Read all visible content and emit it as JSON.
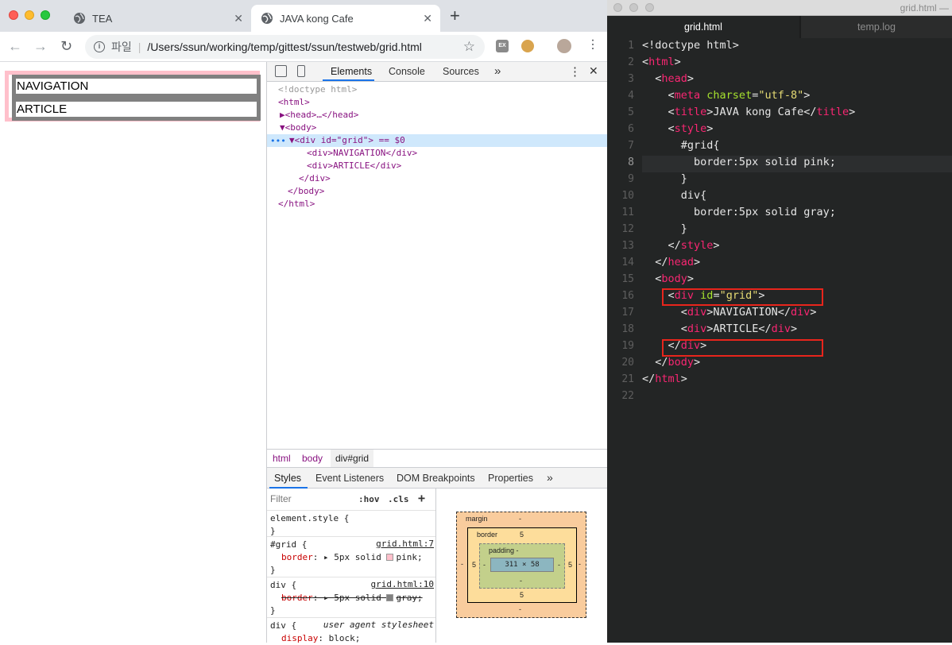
{
  "browser": {
    "tabs": [
      {
        "title": "TEA",
        "active": false
      },
      {
        "title": "JAVA kong Cafe",
        "active": true
      }
    ],
    "omnibox": {
      "label": "파일",
      "url": "/Users/ssun/working/temp/gittest/ssun/testweb/grid.html"
    }
  },
  "page": {
    "items": [
      "NAVIGATION",
      "ARTICLE"
    ]
  },
  "devtools": {
    "tabs": [
      "Elements",
      "Console",
      "Sources",
      "»"
    ],
    "tree": [
      {
        "text": "<!doctype html>"
      },
      {
        "text": "<html>"
      },
      {
        "text": "▶<head>…</head>"
      },
      {
        "text": "▼<body>"
      },
      {
        "text": "▼<div id=\"grid\"> == $0"
      },
      {
        "text": "<div>NAVIGATION</div>"
      },
      {
        "text": "<div>ARTICLE</div>"
      },
      {
        "text": "</div>"
      },
      {
        "text": "</body>"
      },
      {
        "text": "</html>"
      }
    ],
    "breadcrumb": [
      "html",
      "body",
      "div#grid"
    ],
    "sub_tabs": [
      "Styles",
      "Event Listeners",
      "DOM Breakpoints",
      "Properties",
      "»"
    ],
    "filter_placeholder": "Filter",
    "filter_opts": [
      ":hov",
      ".cls",
      "+"
    ],
    "rules": [
      {
        "selector": "element.style {",
        "close": "}"
      },
      {
        "selector": "#grid {",
        "source": "grid.html:7",
        "prop": "border",
        "value": "5px solid",
        "color": "pink",
        "close": "}"
      },
      {
        "selector": "div {",
        "source": "grid.html:10",
        "prop": "border",
        "value": "5px solid",
        "color": "gray",
        "close": "}"
      },
      {
        "selector": "div {",
        "source": "user agent stylesheet",
        "prop": "display",
        "value": "block"
      }
    ],
    "box_model": {
      "margin_label": "margin",
      "margin": "-",
      "border_label": "border",
      "border": "5",
      "padding_label": "padding -",
      "padding": "-",
      "content": "311 × 58"
    }
  },
  "editor": {
    "title": "grid.html —",
    "tabs": [
      "grid.html",
      "temp.log"
    ],
    "lines": [
      "<!doctype html>",
      "<html>",
      "  <head>",
      "    <meta charset=\"utf-8\">",
      "    <title>JAVA kong Cafe</title>",
      "    <style>",
      "      #grid{",
      "        border:5px solid pink;",
      "      }",
      "      div{",
      "        border:5px solid gray;",
      "      }",
      "    </style>",
      "  </head>",
      "  <body>",
      "    <div id=\"grid\">",
      "      <div>NAVIGATION</div>",
      "      <div>ARTICLE</div>",
      "    </div>",
      "  </body>",
      "</html>",
      ""
    ]
  }
}
